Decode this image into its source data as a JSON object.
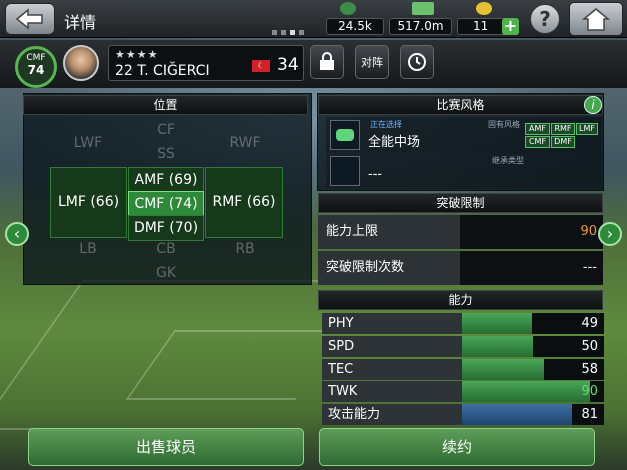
{
  "header": {
    "title": "详情",
    "currency": [
      {
        "icon": "gem-icon",
        "value": "24.5k"
      },
      {
        "icon": "gp-money-icon",
        "value": "517.0m"
      },
      {
        "icon": "coin-icon",
        "value": "11"
      }
    ],
    "help_label": "?"
  },
  "player": {
    "position_label": "CMF",
    "overall": "74",
    "stars": "★★★★",
    "name": "22 T. CIĞERCI",
    "rating": "34",
    "flag_colors": [
      "#d2202a",
      "#ffffff"
    ],
    "buttons": {
      "matchup": "对阵"
    }
  },
  "positions": {
    "header": "位置",
    "slots": {
      "CF": "CF",
      "LWF": "LWF",
      "RWF": "RWF",
      "SS": "SS",
      "AMF": "AMF (69)",
      "LMF": "LMF (66)",
      "CMF": "CMF (74)",
      "RMF": "RMF (66)",
      "DMF": "DMF (70)",
      "LB": "LB",
      "CB": "CB",
      "RB": "RB",
      "GK": "GK"
    }
  },
  "play_style": {
    "header": "比赛风格",
    "current_tag": "正在选择",
    "own_tag": "固有风格",
    "current_name": "全能中场",
    "own_styles": [
      "AMF",
      "RMF",
      "LMF",
      "CMF",
      "DMF"
    ],
    "inherit_tag": "继承类型",
    "inherit_value": "---"
  },
  "breakthrough": {
    "header": "突破限制",
    "rows": [
      {
        "label": "能力上限",
        "value": "90",
        "color": "#f39a2d"
      },
      {
        "label": "突破限制次数",
        "value": "---",
        "color": "#ffffff"
      }
    ]
  },
  "abilities": {
    "header": "能力",
    "rows": [
      {
        "label": "PHY",
        "value": 49,
        "color": "#ffffff"
      },
      {
        "label": "SPD",
        "value": 50,
        "color": "#ffffff"
      },
      {
        "label": "TEC",
        "value": 58,
        "color": "#ffffff"
      },
      {
        "label": "TWK",
        "value": 90,
        "color": "#5fe06b"
      },
      {
        "label": "攻击能力",
        "value": 81,
        "color": "#ffffff"
      }
    ]
  },
  "footer": {
    "sell": "出售球员",
    "renew": "续约"
  }
}
